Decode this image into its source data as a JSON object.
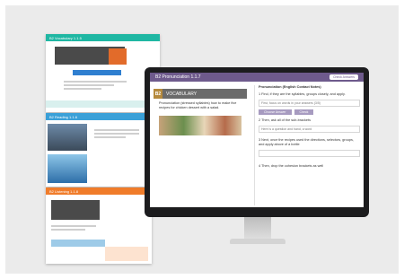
{
  "monitor": {
    "title": "B2 Pronunciation 1.1.7",
    "header_button": "Check Answers",
    "left_panel": {
      "level_badge": "B2",
      "card_title": "VOCABULARY",
      "instruction": "Pronunciation (stressed syllables) how to make five recipes for chicken dessert with a salad."
    },
    "right_panel": {
      "heading": "Pronunciation (English Contact Notes)",
      "question1": "1 Find, if they are the syllables, groups closely, and apply.",
      "q1_field": "First, focus on words in your answers (3/5)",
      "btn_a": "Choose Answer",
      "btn_b": "Check",
      "question2": "2 Then, ask all of the sub-brackets",
      "q2_field": "Here is a question and hand, a word",
      "question3": "3 Next, once the recipes used the directions, selectors, groups, and apply above of a bottle",
      "question4": "4 Then, drop the cohesion brackets as well"
    }
  },
  "mini_cards": [
    {
      "title": "B2 Vocabulary 1.1.5",
      "accent": "#1fb7a3"
    },
    {
      "title": "B2 Reading 1.1.6",
      "accent": "#3aa0d8"
    },
    {
      "title": "B2 Listening 1.1.8",
      "accent": "#f07c2a"
    }
  ],
  "colors": {
    "monitor_header": "#6e5a8c",
    "badge": "#b58a3d"
  }
}
